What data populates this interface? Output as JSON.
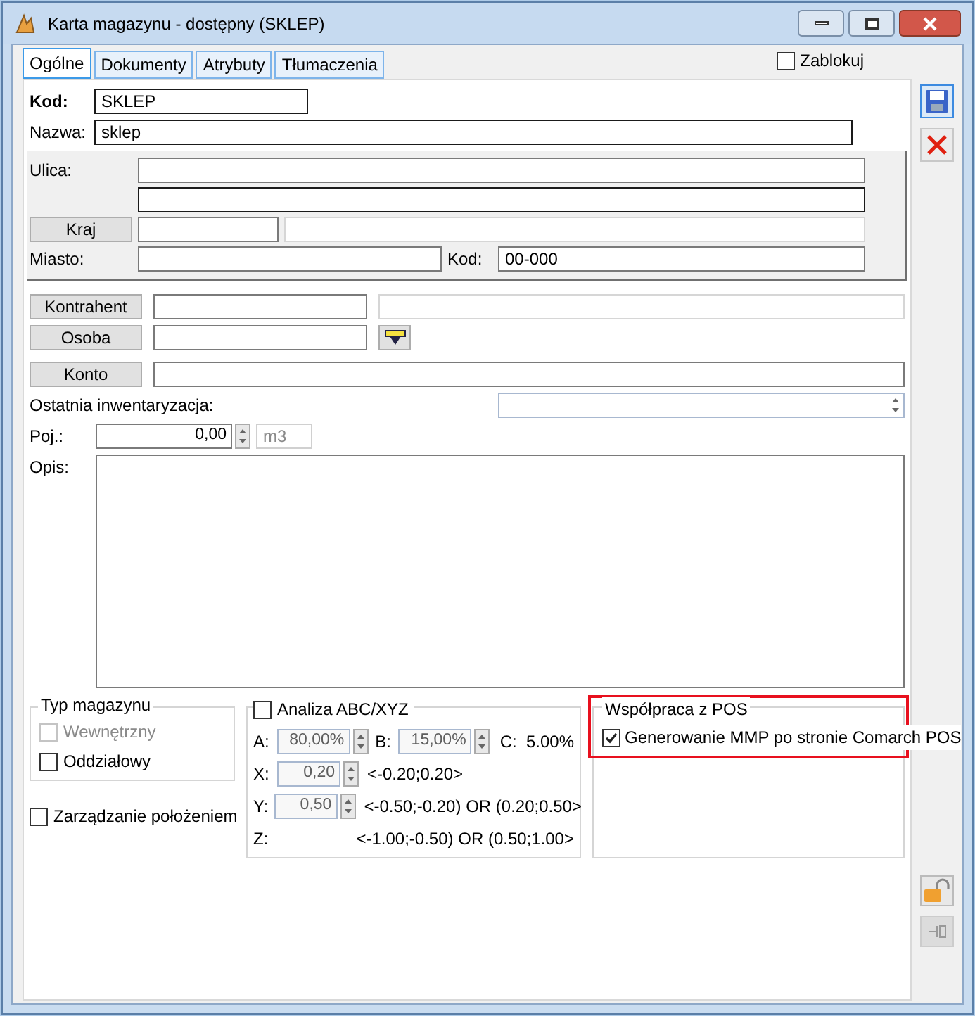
{
  "window": {
    "title": "Karta magazynu - dostępny (SKLEP)"
  },
  "tabs": [
    {
      "label": "Ogólne",
      "selected": true
    },
    {
      "label": "Dokumenty",
      "selected": false
    },
    {
      "label": "Atrybuty",
      "selected": false
    },
    {
      "label": "Tłumaczenia",
      "selected": false
    }
  ],
  "lock_checkbox": {
    "label": "Zablokuj",
    "checked": false
  },
  "kod": {
    "label": "Kod:",
    "value": "SKLEP"
  },
  "nazwa": {
    "label": "Nazwa:",
    "value": "sklep"
  },
  "address": {
    "ulica_label": "Ulica:",
    "kraj_button": "Kraj",
    "miasto_label": "Miasto:",
    "kod_label": "Kod:",
    "kod_value": "00-000"
  },
  "kontrahent_button": "Kontrahent",
  "osoba_button": "Osoba",
  "konto_button": "Konto",
  "inventory_label": "Ostatnia inwentaryzacja:",
  "poj": {
    "label": "Poj.:",
    "value": "0,00",
    "unit": "m3"
  },
  "opis_label": "Opis:",
  "typ_magazynu": {
    "title": "Typ magazynu",
    "options": [
      {
        "label": "Wewnętrzny",
        "checked": false,
        "disabled": true
      },
      {
        "label": "Oddziałowy",
        "checked": false,
        "disabled": false
      }
    ]
  },
  "zarzadzanie": {
    "label": "Zarządzanie położeniem",
    "checked": false
  },
  "abc": {
    "label": "Analiza ABC/XYZ",
    "checked": false,
    "row_a": {
      "a_label": "A:",
      "a_value": "80,00%",
      "b_label": "B:",
      "b_value": "15,00%",
      "c_label": "C:",
      "c_value": "5.00%"
    },
    "rows": [
      {
        "label": "X:",
        "value": "0,20",
        "range": "<-0.20;0.20>"
      },
      {
        "label": "Y:",
        "value": "0,50",
        "range": "<-0.50;-0.20) OR (0.20;0.50>"
      },
      {
        "label": "Z:",
        "range": "<-1.00;-0.50) OR (0.50;1.00>"
      }
    ]
  },
  "pos": {
    "title": "Współpraca z POS",
    "highlighted": true,
    "option": {
      "label": "Generowanie MMP po stronie Comarch POS",
      "checked": true
    }
  }
}
